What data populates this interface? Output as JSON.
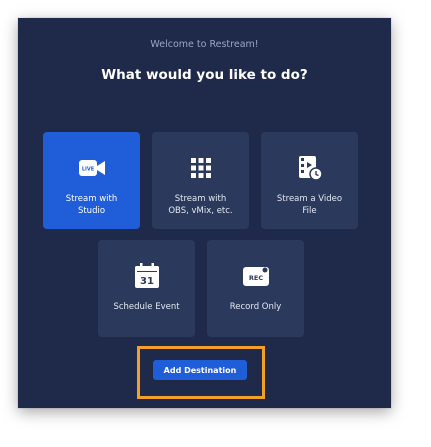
{
  "header": {
    "welcome": "Welcome to Restream!",
    "title": "What would you like to do?"
  },
  "options": [
    {
      "label": "Stream with\nStudio",
      "icon": "live-camera-icon",
      "selected": true
    },
    {
      "label": "Stream with\nOBS, vMix, etc.",
      "icon": "grid-icon",
      "selected": false
    },
    {
      "label": "Stream a Video\nFile",
      "icon": "video-file-icon",
      "selected": false
    },
    {
      "label": "Schedule Event",
      "icon": "calendar-icon",
      "selected": false,
      "icon_text": "31"
    },
    {
      "label": "Record Only",
      "icon": "rec-icon",
      "selected": false,
      "icon_text": "REC"
    }
  ],
  "live_badge": "LIVE",
  "actions": {
    "add_destination": "Add Destination"
  },
  "colors": {
    "modal_bg": "#1f2a4a",
    "card_bg": "#2b3a5c",
    "accent": "#1f5ed8",
    "highlight": "#f3a02a"
  }
}
